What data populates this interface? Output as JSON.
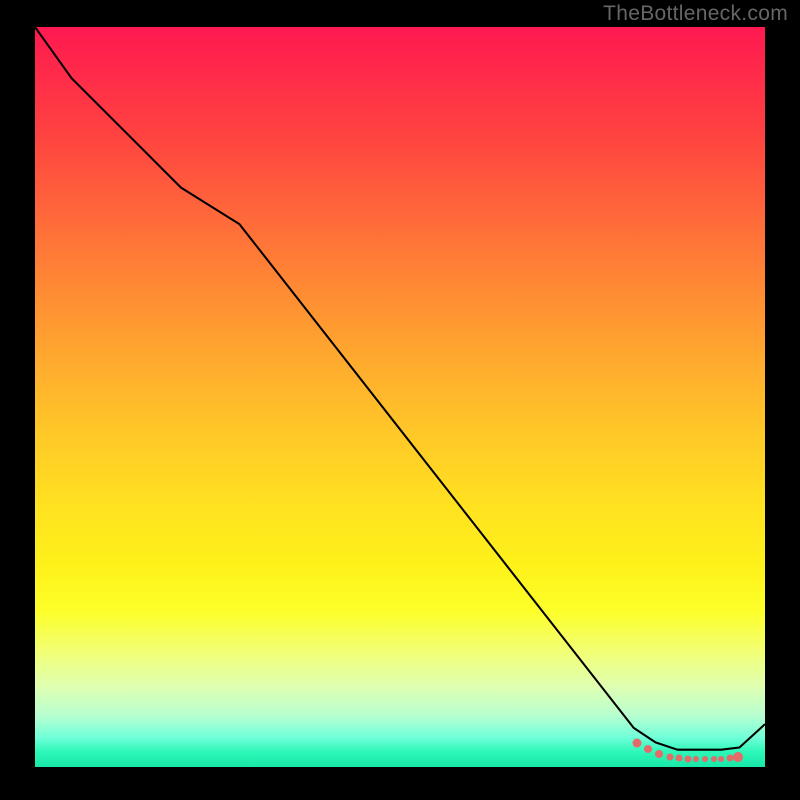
{
  "watermark": "TheBottleneck.com",
  "chart_data": {
    "type": "line",
    "title": "",
    "xlabel": "",
    "ylabel": "",
    "xlim": [
      0,
      100
    ],
    "ylim": [
      0,
      100
    ],
    "grid": false,
    "legend": false,
    "line": {
      "x": [
        0,
        5,
        12,
        20,
        28,
        82,
        85,
        88,
        91,
        94,
        96.5,
        100
      ],
      "y": [
        100,
        93,
        86,
        78,
        73,
        4,
        2,
        1,
        1,
        1,
        1.3,
        4.5
      ],
      "note": "y is plotted inverted (0 at bottom). Curve descends from top-left, knee near x≈28, then near-linear drop to flat trough around y≈1 over x≈85–96, slight uptick at far right."
    },
    "markers": {
      "x": [
        82.5,
        84,
        85.5,
        87,
        88.2,
        89.5,
        90.5,
        91.8,
        93,
        94,
        95.2,
        96.3
      ],
      "y": [
        3.2,
        2.4,
        1.8,
        1.4,
        1.2,
        1.1,
        1.05,
        1.05,
        1.1,
        1.1,
        1.2,
        1.3
      ],
      "sizes": [
        9,
        8,
        8,
        7,
        7,
        7,
        6,
        6,
        6,
        6,
        7,
        10
      ],
      "color": "#e56a6a"
    },
    "background_gradient": {
      "direction": "vertical",
      "top_color": "#ff1850",
      "bottom_color": "#18e8a8"
    }
  }
}
